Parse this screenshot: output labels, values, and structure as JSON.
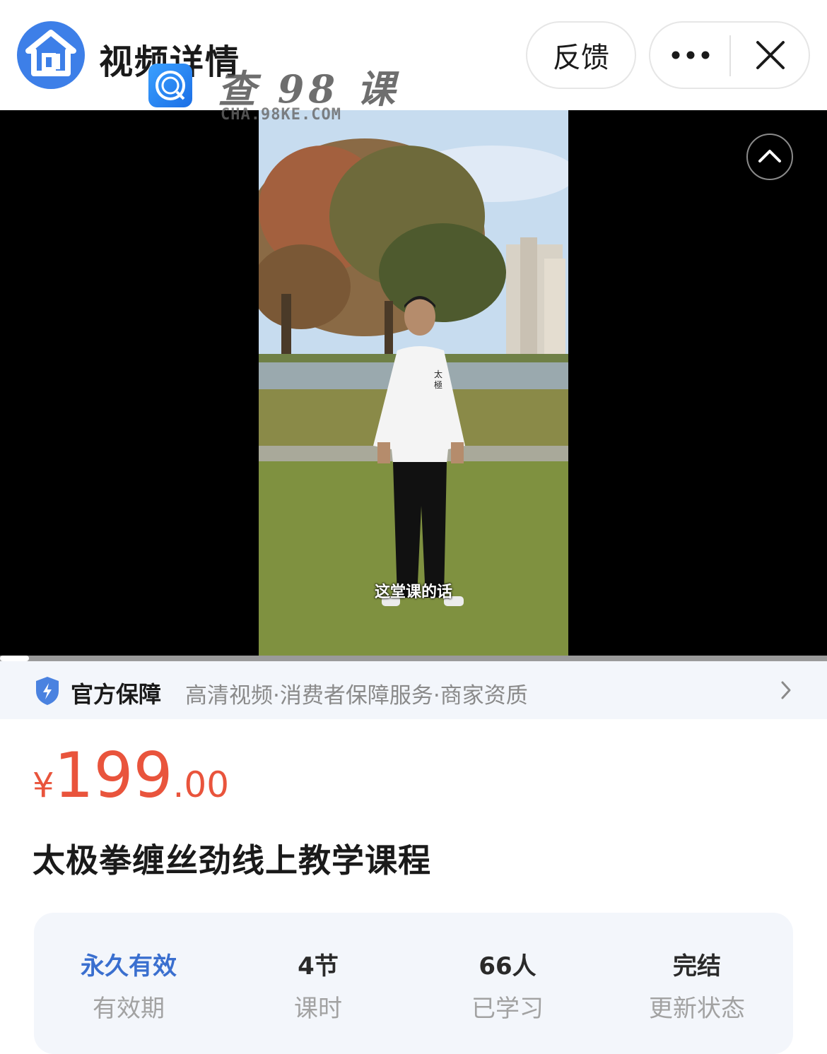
{
  "header": {
    "title": "视频详情",
    "feedback_label": "反馈",
    "icons": [
      "app-logo-icon",
      "more-icon",
      "close-icon"
    ]
  },
  "watermark": {
    "text": "查 98 课",
    "sub": "CHA.98KE.COM"
  },
  "video": {
    "subtitle": "这堂课的话",
    "progress": 0.035
  },
  "guarantee": {
    "title": "官方保障",
    "items": "高清视频·消费者保障服务·商家资质"
  },
  "price": {
    "currency": "¥",
    "integer": "199",
    "decimal": ".00"
  },
  "course": {
    "title": "太极拳缠丝劲线上教学课程"
  },
  "stats": [
    {
      "value": "永久有效",
      "label": "有效期"
    },
    {
      "value": "4节",
      "label": "课时"
    },
    {
      "value": "66人",
      "label": "已学习"
    },
    {
      "value": "完结",
      "label": "更新状态"
    }
  ],
  "colors": {
    "accent_blue": "#3a6fcf",
    "price_red": "#e9543c",
    "logo_blue": "#3d7fe8"
  }
}
